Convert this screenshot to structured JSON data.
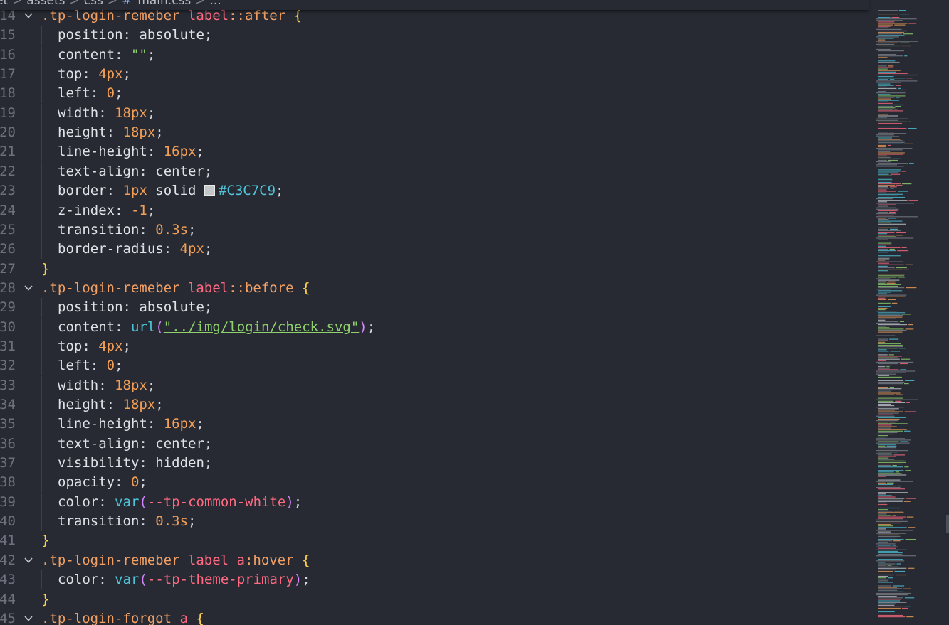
{
  "breadcrumb": {
    "parts": [
      "et",
      "assets",
      "css",
      "main.css",
      "..."
    ],
    "separator": ">",
    "file_icon": "#"
  },
  "editor": {
    "lines": [
      {
        "n": "14",
        "fold": true,
        "tokens": [
          [
            "sel",
            ".tp-login-remeber "
          ],
          [
            "tag",
            "label"
          ],
          [
            "sel",
            "::after "
          ],
          [
            "b1",
            "{"
          ]
        ]
      },
      {
        "n": "15",
        "tokens": [
          [
            "prop",
            "position"
          ],
          [
            "punct",
            ": "
          ],
          [
            "kw",
            "absolute"
          ],
          [
            "punct",
            ";"
          ]
        ]
      },
      {
        "n": "16",
        "tokens": [
          [
            "prop",
            "content"
          ],
          [
            "punct",
            ": "
          ],
          [
            "str",
            "\"\""
          ],
          [
            "punct",
            ";"
          ]
        ]
      },
      {
        "n": "17",
        "tokens": [
          [
            "prop",
            "top"
          ],
          [
            "punct",
            ": "
          ],
          [
            "num",
            "4px"
          ],
          [
            "punct",
            ";"
          ]
        ]
      },
      {
        "n": "18",
        "tokens": [
          [
            "prop",
            "left"
          ],
          [
            "punct",
            ": "
          ],
          [
            "num",
            "0"
          ],
          [
            "punct",
            ";"
          ]
        ]
      },
      {
        "n": "19",
        "tokens": [
          [
            "prop",
            "width"
          ],
          [
            "punct",
            ": "
          ],
          [
            "num",
            "18px"
          ],
          [
            "punct",
            ";"
          ]
        ]
      },
      {
        "n": "20",
        "tokens": [
          [
            "prop",
            "height"
          ],
          [
            "punct",
            ": "
          ],
          [
            "num",
            "18px"
          ],
          [
            "punct",
            ";"
          ]
        ]
      },
      {
        "n": "21",
        "tokens": [
          [
            "prop",
            "line-height"
          ],
          [
            "punct",
            ": "
          ],
          [
            "num",
            "16px"
          ],
          [
            "punct",
            ";"
          ]
        ]
      },
      {
        "n": "22",
        "tokens": [
          [
            "prop",
            "text-align"
          ],
          [
            "punct",
            ": "
          ],
          [
            "kw",
            "center"
          ],
          [
            "punct",
            ";"
          ]
        ]
      },
      {
        "n": "23",
        "tokens": [
          [
            "prop",
            "border"
          ],
          [
            "punct",
            ": "
          ],
          [
            "num",
            "1px "
          ],
          [
            "kw",
            "solid "
          ],
          [
            "swatch",
            ""
          ],
          [
            "hex",
            "#C3C7C9"
          ],
          [
            "punct",
            ";"
          ]
        ]
      },
      {
        "n": "24",
        "tokens": [
          [
            "prop",
            "z-index"
          ],
          [
            "punct",
            ": "
          ],
          [
            "num",
            "-1"
          ],
          [
            "punct",
            ";"
          ]
        ]
      },
      {
        "n": "25",
        "tokens": [
          [
            "prop",
            "transition"
          ],
          [
            "punct",
            ": "
          ],
          [
            "num",
            "0.3s"
          ],
          [
            "punct",
            ";"
          ]
        ]
      },
      {
        "n": "26",
        "tokens": [
          [
            "prop",
            "border-radius"
          ],
          [
            "punct",
            ": "
          ],
          [
            "num",
            "4px"
          ],
          [
            "punct",
            ";"
          ]
        ]
      },
      {
        "n": "27",
        "close": true,
        "tokens": [
          [
            "b1",
            "}"
          ]
        ]
      },
      {
        "n": "28",
        "fold": true,
        "tokens": [
          [
            "sel",
            ".tp-login-remeber "
          ],
          [
            "tag",
            "label"
          ],
          [
            "sel",
            "::before "
          ],
          [
            "b1",
            "{"
          ]
        ]
      },
      {
        "n": "29",
        "tokens": [
          [
            "prop",
            "position"
          ],
          [
            "punct",
            ": "
          ],
          [
            "kw",
            "absolute"
          ],
          [
            "punct",
            ";"
          ]
        ]
      },
      {
        "n": "30",
        "tokens": [
          [
            "prop",
            "content"
          ],
          [
            "punct",
            ": "
          ],
          [
            "fn",
            "url"
          ],
          [
            "b2",
            "("
          ],
          [
            "url-str",
            "\"../img/login/check.svg\""
          ],
          [
            "b2",
            ")"
          ],
          [
            "punct",
            ";"
          ]
        ]
      },
      {
        "n": "31",
        "tokens": [
          [
            "prop",
            "top"
          ],
          [
            "punct",
            ": "
          ],
          [
            "num",
            "4px"
          ],
          [
            "punct",
            ";"
          ]
        ]
      },
      {
        "n": "32",
        "tokens": [
          [
            "prop",
            "left"
          ],
          [
            "punct",
            ": "
          ],
          [
            "num",
            "0"
          ],
          [
            "punct",
            ";"
          ]
        ]
      },
      {
        "n": "33",
        "tokens": [
          [
            "prop",
            "width"
          ],
          [
            "punct",
            ": "
          ],
          [
            "num",
            "18px"
          ],
          [
            "punct",
            ";"
          ]
        ]
      },
      {
        "n": "34",
        "tokens": [
          [
            "prop",
            "height"
          ],
          [
            "punct",
            ": "
          ],
          [
            "num",
            "18px"
          ],
          [
            "punct",
            ";"
          ]
        ]
      },
      {
        "n": "35",
        "tokens": [
          [
            "prop",
            "line-height"
          ],
          [
            "punct",
            ": "
          ],
          [
            "num",
            "16px"
          ],
          [
            "punct",
            ";"
          ]
        ]
      },
      {
        "n": "36",
        "tokens": [
          [
            "prop",
            "text-align"
          ],
          [
            "punct",
            ": "
          ],
          [
            "kw",
            "center"
          ],
          [
            "punct",
            ";"
          ]
        ]
      },
      {
        "n": "37",
        "tokens": [
          [
            "prop",
            "visibility"
          ],
          [
            "punct",
            ": "
          ],
          [
            "kw",
            "hidden"
          ],
          [
            "punct",
            ";"
          ]
        ]
      },
      {
        "n": "38",
        "tokens": [
          [
            "prop",
            "opacity"
          ],
          [
            "punct",
            ": "
          ],
          [
            "num",
            "0"
          ],
          [
            "punct",
            ";"
          ]
        ]
      },
      {
        "n": "39",
        "tokens": [
          [
            "prop",
            "color"
          ],
          [
            "punct",
            ": "
          ],
          [
            "fn",
            "var"
          ],
          [
            "b2",
            "("
          ],
          [
            "var",
            "--tp-common-white"
          ],
          [
            "b2",
            ")"
          ],
          [
            "punct",
            ";"
          ]
        ]
      },
      {
        "n": "40",
        "tokens": [
          [
            "prop",
            "transition"
          ],
          [
            "punct",
            ": "
          ],
          [
            "num",
            "0.3s"
          ],
          [
            "punct",
            ";"
          ]
        ]
      },
      {
        "n": "41",
        "close": true,
        "tokens": [
          [
            "b1",
            "}"
          ]
        ]
      },
      {
        "n": "42",
        "fold": true,
        "tokens": [
          [
            "sel",
            ".tp-login-remeber "
          ],
          [
            "tag",
            "label a"
          ],
          [
            "sel",
            ":hover "
          ],
          [
            "b1",
            "{"
          ]
        ]
      },
      {
        "n": "43",
        "tokens": [
          [
            "prop",
            "color"
          ],
          [
            "punct",
            ": "
          ],
          [
            "fn",
            "var"
          ],
          [
            "b2",
            "("
          ],
          [
            "var",
            "--tp-theme-primary"
          ],
          [
            "b2",
            ")"
          ],
          [
            "punct",
            ";"
          ]
        ]
      },
      {
        "n": "44",
        "close": true,
        "tokens": [
          [
            "b1",
            "}"
          ]
        ]
      },
      {
        "n": "45",
        "fold": true,
        "tokens": [
          [
            "sel",
            ".tp-login-forgot "
          ],
          [
            "tag",
            "a "
          ],
          [
            "b1",
            "{"
          ]
        ]
      }
    ]
  },
  "colors": {
    "background": "#272a33",
    "gutter": "#6c717b",
    "minimap_colors": [
      "#7d828b",
      "#c9ccd1",
      "#f39f56",
      "#ff6a80",
      "#4fc4d8",
      "#8fd26d"
    ]
  }
}
